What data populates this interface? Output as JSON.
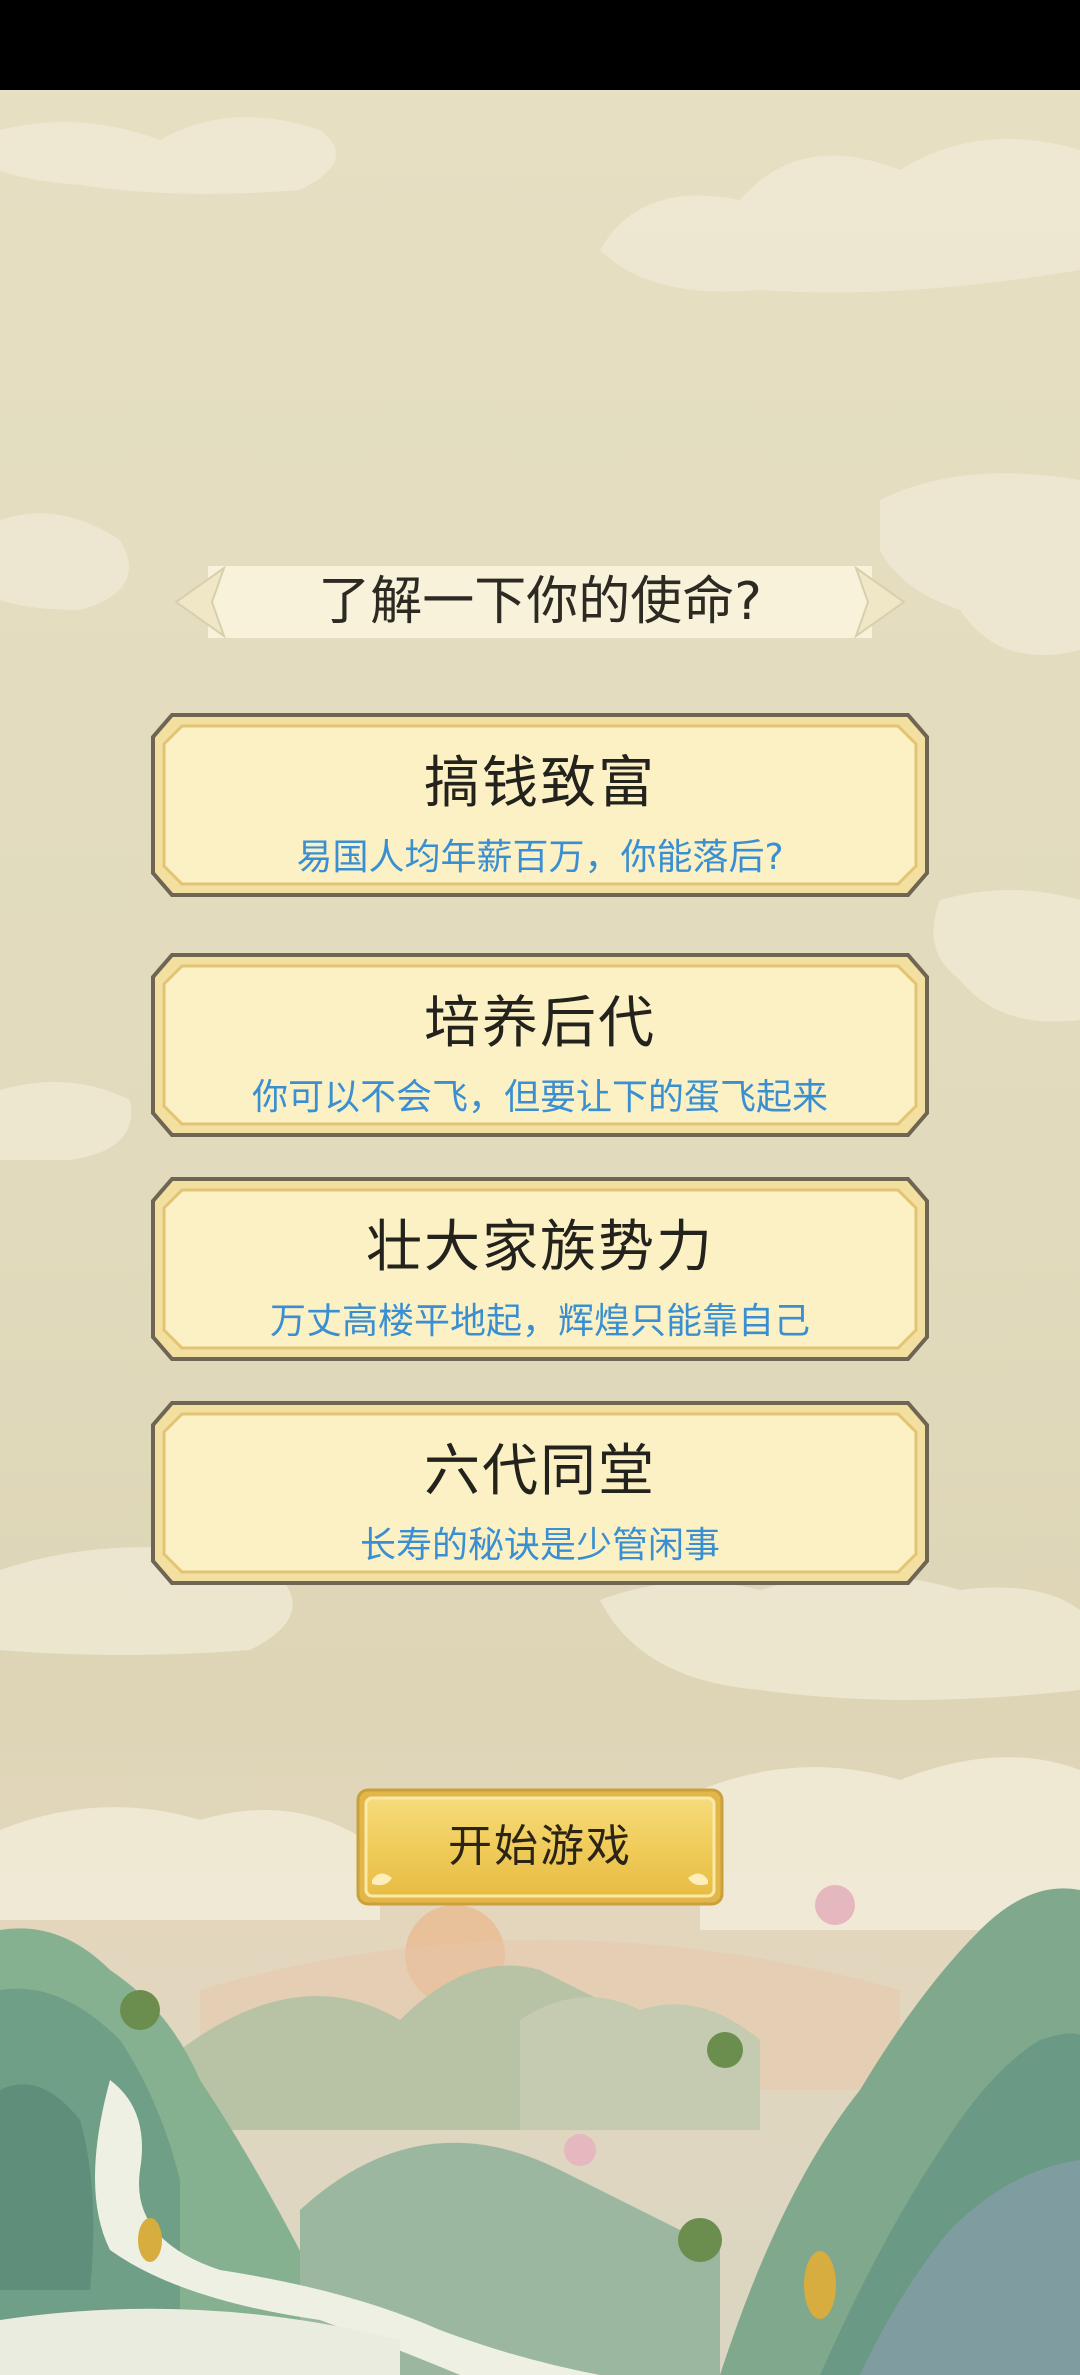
{
  "title": "了解一下你的使命?",
  "options": [
    {
      "title": "搞钱致富",
      "desc": "易国人均年薪百万，你能落后?"
    },
    {
      "title": "培养后代",
      "desc": "你可以不会飞，但要让下的蛋飞起来"
    },
    {
      "title": "壮大家族势力",
      "desc": "万丈高楼平地起，辉煌只能靠自己"
    },
    {
      "title": "六代同堂",
      "desc": "长寿的秘诀是少管闲事"
    }
  ],
  "start_button": {
    "label": "开始游戏"
  },
  "colors": {
    "background": "#e3dcc0",
    "card_fill": "#fbf1c4",
    "card_border": "#6e6554",
    "desc_text": "#3a8fd2",
    "button_gold": "#f0cc5a"
  }
}
